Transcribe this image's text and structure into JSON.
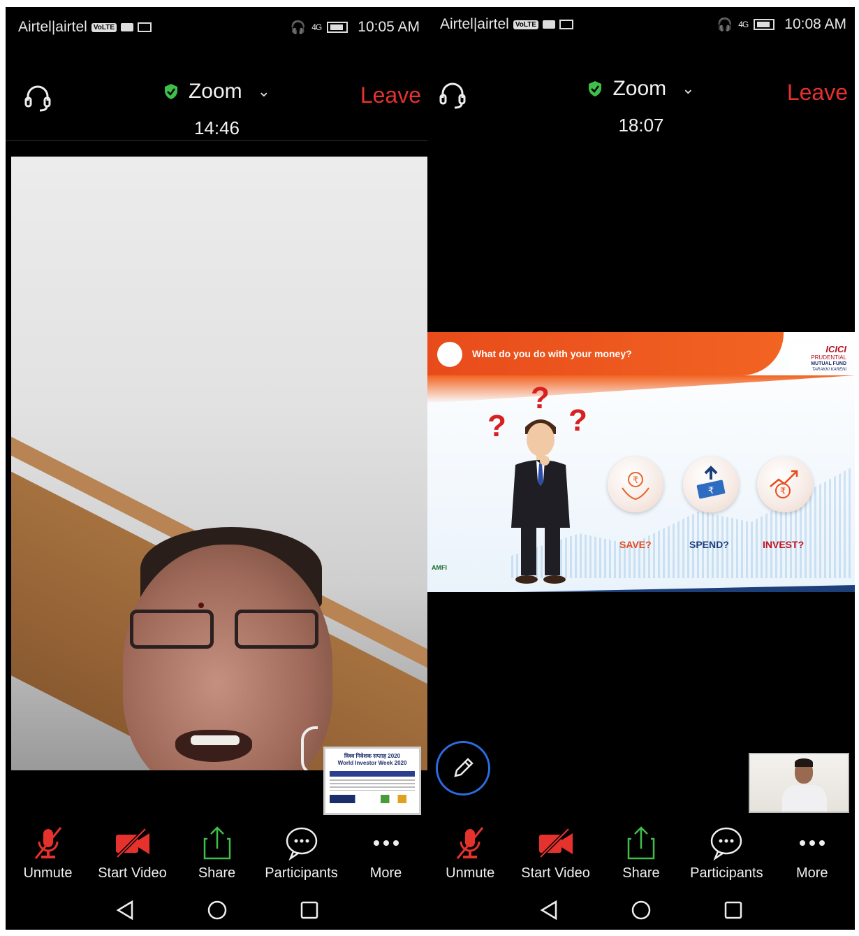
{
  "left": {
    "status": {
      "carrier": "Airtel|airtel",
      "volte": "VoLTE",
      "net": "4G",
      "time": "10:05 AM"
    },
    "top": {
      "title": "Zoom",
      "timer": "14:46",
      "leave": "Leave"
    },
    "self_view": {
      "line1": "विश्व निवेशक सप्ताह 2020",
      "line2": "World Investor Week 2020"
    },
    "toolbar": {
      "unmute": "Unmute",
      "start_video": "Start Video",
      "share": "Share",
      "participants": "Participants",
      "more": "More"
    }
  },
  "right": {
    "status": {
      "carrier": "Airtel|airtel",
      "volte": "VoLTE",
      "net": "4G",
      "time": "10:08 AM"
    },
    "top": {
      "title": "Zoom",
      "timer": "18:07",
      "leave": "Leave"
    },
    "slide": {
      "title": "What do you do with your money?",
      "brand_l1": "ICICI",
      "brand_l2": "PRUDENTIAL",
      "brand_l3": "MUTUAL FUND",
      "brand_l4": "TARAKKI KARENI",
      "amfi": "AMFI",
      "choices": [
        "SAVE?",
        "SPEND?",
        "INVEST?"
      ]
    },
    "toolbar": {
      "unmute": "Unmute",
      "start_video": "Start Video",
      "share": "Share",
      "participants": "Participants",
      "more": "More"
    }
  },
  "colors": {
    "leave": "#e5322d",
    "muted_red": "#e5322d",
    "share_green": "#3fbf4a",
    "shield_green": "#3fbf4a",
    "annotate_blue": "#2d6cdf",
    "slide_orange": "#f26422"
  }
}
